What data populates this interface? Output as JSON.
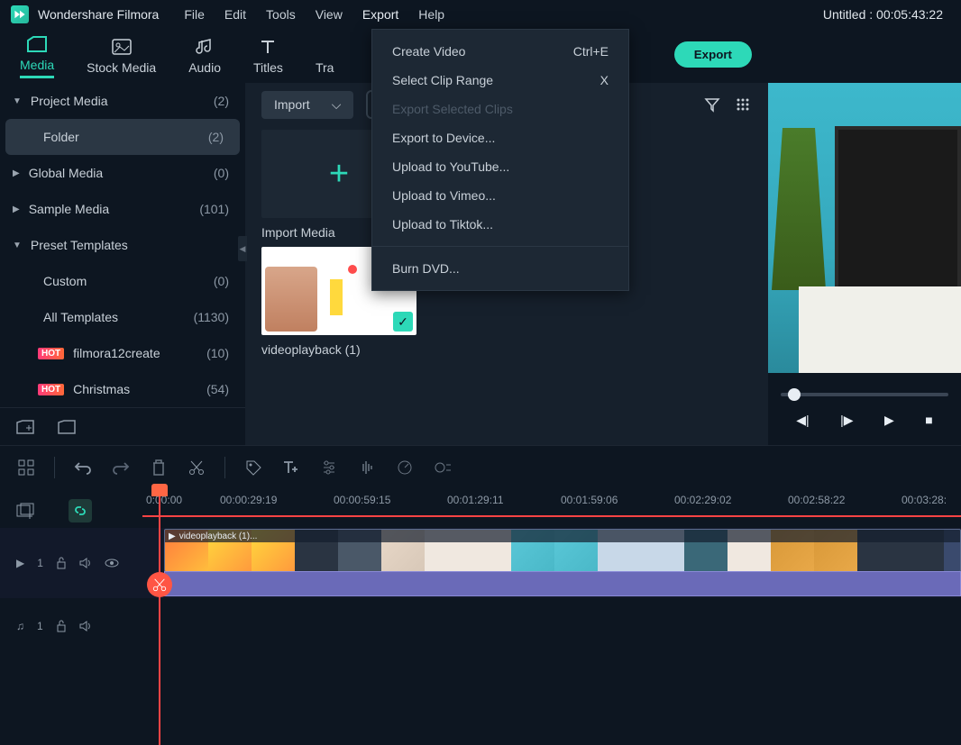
{
  "app": {
    "name": "Wondershare Filmora",
    "title_right": "Untitled : 00:05:43:22"
  },
  "menubar": {
    "file": "File",
    "edit": "Edit",
    "tools": "Tools",
    "view": "View",
    "export": "Export",
    "help": "Help"
  },
  "tabs": {
    "media": "Media",
    "stock": "Stock Media",
    "audio": "Audio",
    "titles": "Titles",
    "transitions": "Transitions"
  },
  "buttons": {
    "export": "Export",
    "import": "Import"
  },
  "sidebar": {
    "project_media": {
      "label": "Project Media",
      "count": "(2)"
    },
    "folder": {
      "label": "Folder",
      "count": "(2)"
    },
    "global_media": {
      "label": "Global Media",
      "count": "(0)"
    },
    "sample_media": {
      "label": "Sample Media",
      "count": "(101)"
    },
    "preset_templates": {
      "label": "Preset Templates"
    },
    "custom": {
      "label": "Custom",
      "count": "(0)"
    },
    "all_templates": {
      "label": "All Templates",
      "count": "(1130)"
    },
    "filmora12": {
      "label": "filmora12create",
      "count": "(10)",
      "hot": "HOT"
    },
    "christmas": {
      "label": "Christmas",
      "count": "(54)",
      "hot": "HOT"
    }
  },
  "media": {
    "import_label": "Import Media",
    "clip1_label": "videoplayback (1)"
  },
  "export_menu": {
    "create_video": "Create Video",
    "create_video_key": "Ctrl+E",
    "select_clip": "Select Clip Range",
    "select_clip_key": "X",
    "export_selected": "Export Selected Clips",
    "export_device": "Export to Device...",
    "upload_youtube": "Upload to YouTube...",
    "upload_vimeo": "Upload to Vimeo...",
    "upload_tiktok": "Upload to Tiktok...",
    "burn_dvd": "Burn DVD..."
  },
  "timeline": {
    "t0": "0:00:00",
    "t1": "00:00:29:19",
    "t2": "00:00:59:15",
    "t3": "00:01:29:11",
    "t4": "00:01:59:06",
    "t5": "00:02:29:02",
    "t6": "00:02:58:22",
    "t7": "00:03:28:",
    "clip_name": "videoplayback (1)...",
    "video_track": "1",
    "audio_track": "1"
  }
}
